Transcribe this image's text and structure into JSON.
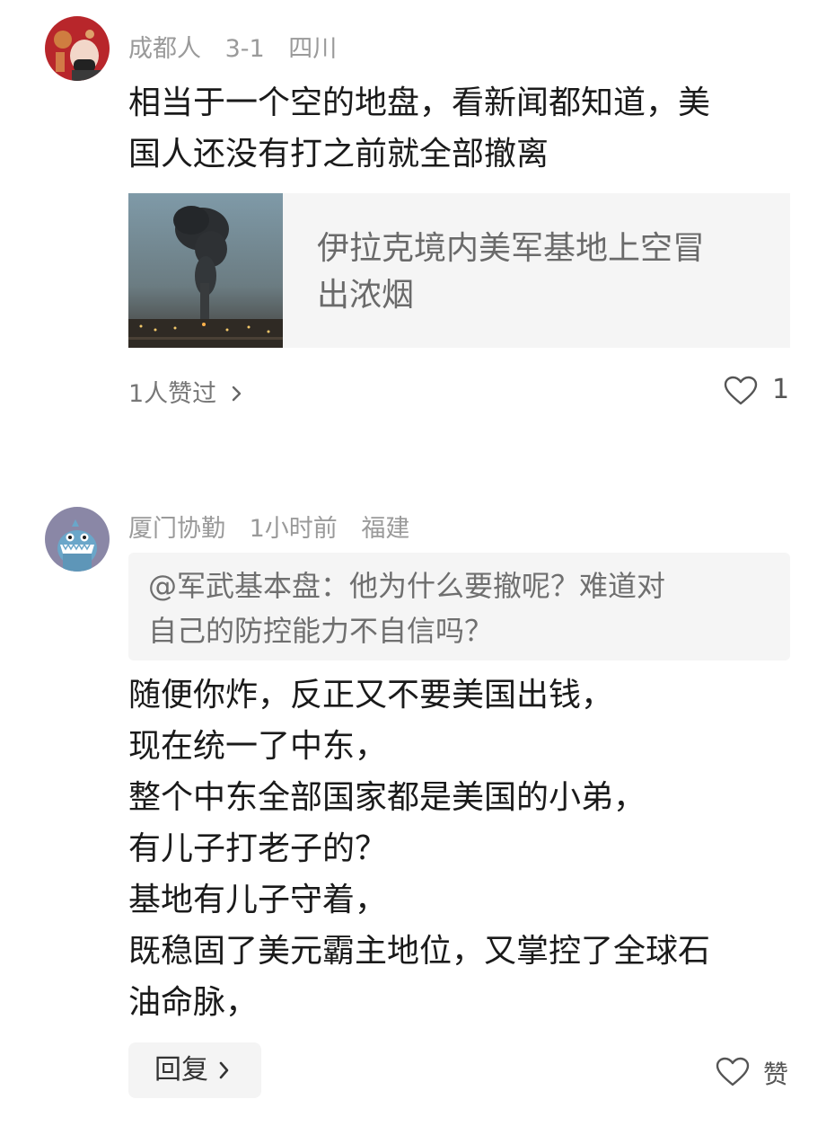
{
  "comments": [
    {
      "user": "成都人",
      "date": "3-1",
      "location": "四川",
      "text_lines": [
        "相当于一个空的地盘，看新闻都知道，美",
        "国人还没有打之前就全部撤离"
      ],
      "link_card": {
        "title_lines": [
          "伊拉克境内美军基地上空冒",
          "出浓烟"
        ]
      },
      "liked_by": "1人赞过",
      "like_count": "1"
    },
    {
      "user": "厦门协勤",
      "date": "1小时前",
      "location": "福建",
      "quote_lines": [
        "@军武基本盘：他为什么要撤呢？难道对",
        "自己的防控能力不自信吗？"
      ],
      "text_lines": [
        "随便你炸，反正又不要美国出钱，",
        "现在统一了中东，",
        "整个中东全部国家都是美国的小弟，",
        "有儿子打老子的？",
        "基地有儿子守着，",
        "既稳固了美元霸主地位，又掌控了全球石",
        "油命脉，"
      ],
      "reply_label": "回复",
      "like_label": "赞"
    }
  ],
  "icons": {
    "heart": "heart-outline-icon",
    "chevron": "chevron-right-icon"
  }
}
